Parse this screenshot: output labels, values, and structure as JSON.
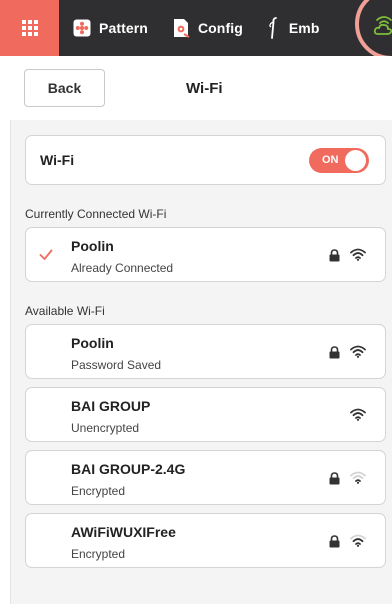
{
  "nav": {
    "tabs": [
      {
        "label": "Pattern",
        "icon": "pattern-icon"
      },
      {
        "label": "Config",
        "icon": "config-icon"
      },
      {
        "label": "Emb",
        "icon": "embroidery-needle-icon"
      }
    ],
    "menu_icon": "grid-menu-icon",
    "cloud_icon": "cloud-wifi-icon"
  },
  "header": {
    "back_label": "Back",
    "title": "Wi-Fi"
  },
  "wifi_toggle": {
    "label": "Wi-Fi",
    "state_label": "ON",
    "on": true
  },
  "connected": {
    "section_label": "Currently Connected Wi-Fi",
    "networks": [
      {
        "name": "Poolin",
        "status": "Already Connected",
        "locked": true,
        "signal": "strong",
        "checked": true
      }
    ]
  },
  "available": {
    "section_label": "Available Wi-Fi",
    "networks": [
      {
        "name": "Poolin",
        "status": "Password Saved",
        "locked": true,
        "signal": "strong"
      },
      {
        "name": "BAI GROUP",
        "status": "Unencrypted",
        "locked": false,
        "signal": "strong"
      },
      {
        "name": "BAI GROUP-2.4G",
        "status": "Encrypted",
        "locked": true,
        "signal": "weak"
      },
      {
        "name": "AWiFiWUXIFree",
        "status": "Encrypted",
        "locked": true,
        "signal": "medium"
      }
    ]
  },
  "colors": {
    "accent": "#f06b5d",
    "topbar": "#2f2f31",
    "panel": "#f4f4f4"
  }
}
